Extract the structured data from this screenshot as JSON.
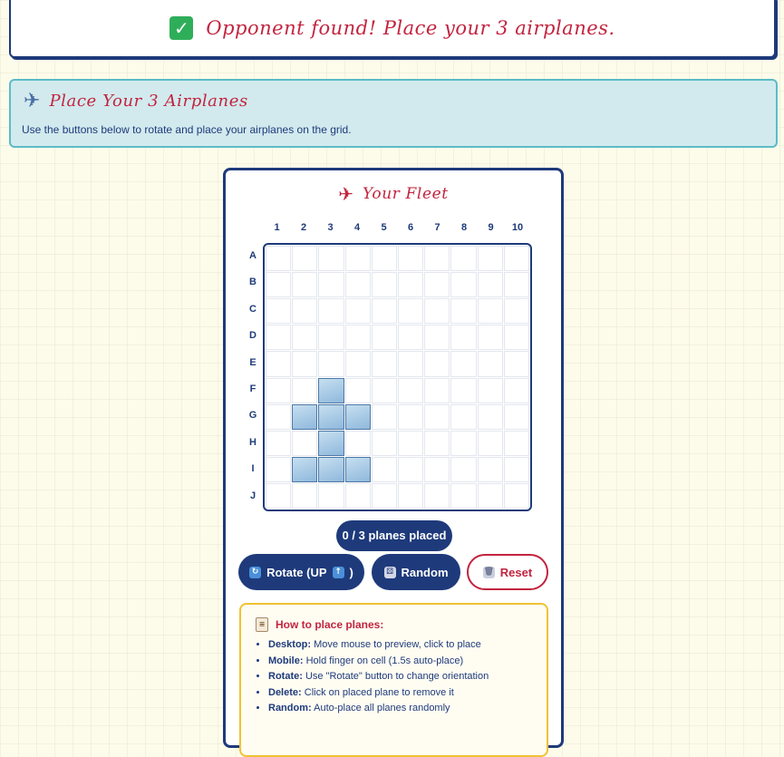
{
  "status": {
    "icon": "check-icon",
    "text": "Opponent found! Place your 3 airplanes."
  },
  "info": {
    "icon": "airplane-icon",
    "title": "Place Your 3 Airplanes",
    "description": "Use the buttons below to rotate and place your airplanes on the grid."
  },
  "fleet": {
    "icon": "airplane-icon",
    "title": "Your Fleet",
    "columns": [
      "1",
      "2",
      "3",
      "4",
      "5",
      "6",
      "7",
      "8",
      "9",
      "10"
    ],
    "rows": [
      "A",
      "B",
      "C",
      "D",
      "E",
      "F",
      "G",
      "H",
      "I",
      "J"
    ],
    "preview_cells": [
      "F3",
      "G2",
      "G3",
      "G4",
      "H3",
      "I2",
      "I3",
      "I4"
    ],
    "preview_color": "#8fb8dc"
  },
  "placed_count": "0 / 3 planes placed",
  "buttons": {
    "rotate": {
      "label": "Rotate (UP",
      "suffix": ")",
      "icon": "rotate-icon",
      "arrow_icon": "up-arrow-icon"
    },
    "random": {
      "label": "Random",
      "icon": "dice-icon"
    },
    "reset": {
      "label": "Reset",
      "icon": "trash-icon"
    }
  },
  "help": {
    "icon": "clipboard-icon",
    "title": "How to place planes:",
    "items": [
      {
        "term": "Desktop:",
        "text": "Move mouse to preview, click to place"
      },
      {
        "term": "Mobile:",
        "text": "Hold finger on cell (1.5s auto-place)"
      },
      {
        "term": "Rotate:",
        "text": "Use \"Rotate\" button to change orientation"
      },
      {
        "term": "Delete:",
        "text": "Click on placed plane to remove it"
      },
      {
        "term": "Random:",
        "text": "Auto-place all planes randomly"
      }
    ]
  },
  "colors": {
    "primary": "#1e3a7b",
    "accent": "#c2243f",
    "info_bg": "#d2eaee",
    "help_border": "#f1c232",
    "background": "#fdfbea"
  }
}
